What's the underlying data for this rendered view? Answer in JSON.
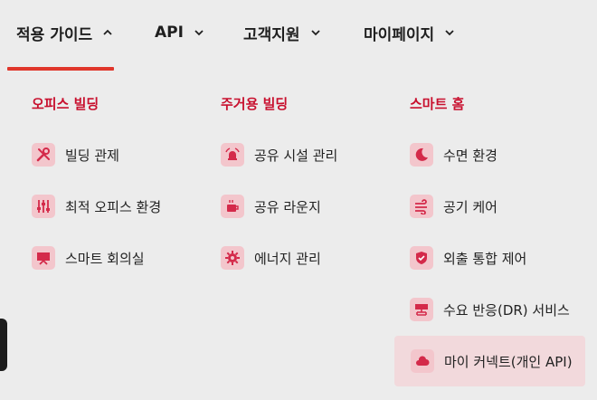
{
  "nav": {
    "items": [
      {
        "label": "적용 가이드",
        "chevron": "up",
        "active": true
      },
      {
        "label": "API",
        "chevron": "down"
      },
      {
        "label": "고객지원",
        "chevron": "down"
      },
      {
        "label": "마이페이지",
        "chevron": "down"
      }
    ]
  },
  "menu": {
    "columns": [
      {
        "heading": "오피스 빌딩",
        "items": [
          {
            "label": "빌딩 관제",
            "icon": "tools-icon"
          },
          {
            "label": "최적 오피스 환경",
            "icon": "sliders-icon"
          },
          {
            "label": "스마트 회의실",
            "icon": "presentation-icon"
          }
        ]
      },
      {
        "heading": "주거용 빌딩",
        "items": [
          {
            "label": "공유 시설 관리",
            "icon": "bell-icon"
          },
          {
            "label": "공유 라운지",
            "icon": "coffee-cup-icon"
          },
          {
            "label": "에너지 관리",
            "icon": "gear-icon"
          }
        ]
      },
      {
        "heading": "스마트 홈",
        "items": [
          {
            "label": "수면 환경",
            "icon": "moon-icon"
          },
          {
            "label": "공기 케어",
            "icon": "wind-icon"
          },
          {
            "label": "외출 통합 제어",
            "icon": "shield-check-icon"
          },
          {
            "label": "수요 반응(DR) 서비스",
            "icon": "network-icon"
          },
          {
            "label": "마이 커넥트(개인 API)",
            "icon": "cloud-icon",
            "highlighted": true
          }
        ]
      }
    ]
  },
  "colors": {
    "accent": "#e0362b",
    "heading": "#c8102e",
    "icon_bg": "#f3c6cc",
    "icon_fg": "#d42a4a",
    "highlight_bg": "#f2d9dc"
  }
}
